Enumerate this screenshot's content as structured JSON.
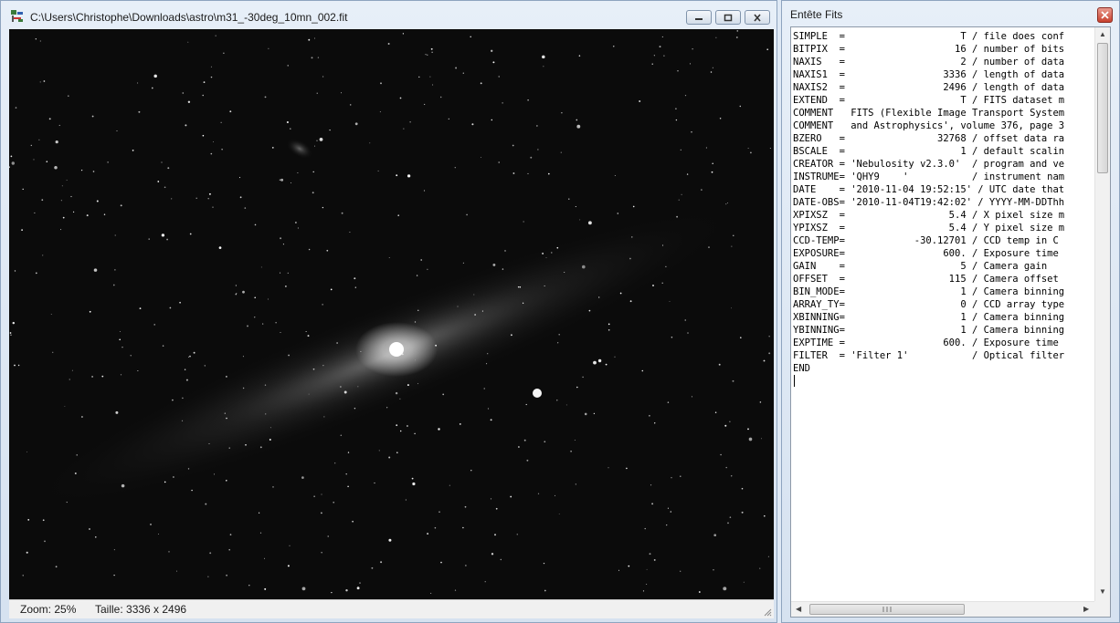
{
  "image_window": {
    "title": "C:\\Users\\Christophe\\Downloads\\astro\\m31_-30deg_10mn_002.fit",
    "icons": [
      "app-icon",
      "minimize-icon",
      "maximize-icon",
      "close-icon"
    ],
    "status": {
      "zoom": "Zoom: 25%",
      "size": "Taille: 3336 x 2496"
    }
  },
  "header_window": {
    "title": "Entête Fits",
    "lines": [
      "SIMPLE  =                    T / file does conf",
      "BITPIX  =                   16 / number of bits",
      "NAXIS   =                    2 / number of data",
      "NAXIS1  =                 3336 / length of data",
      "NAXIS2  =                 2496 / length of data",
      "EXTEND  =                    T / FITS dataset m",
      "COMMENT   FITS (Flexible Image Transport System",
      "COMMENT   and Astrophysics', volume 376, page 3",
      "BZERO   =                32768 / offset data ra",
      "BSCALE  =                    1 / default scalin",
      "CREATOR = 'Nebulosity v2.3.0'  / program and ve",
      "INSTRUME= 'QHY9    '           / instrument nam",
      "DATE    = '2010-11-04 19:52:15' / UTC date that",
      "DATE-OBS= '2010-11-04T19:42:02' / YYYY-MM-DDThh",
      "XPIXSZ  =                  5.4 / X pixel size m",
      "YPIXSZ  =                  5.4 / Y pixel size m",
      "CCD-TEMP=            -30.12701 / CCD temp in C",
      "EXPOSURE=                 600. / Exposure time",
      "GAIN    =                    5 / Camera gain",
      "OFFSET  =                  115 / Camera offset",
      "BIN_MODE=                    1 / Camera binning",
      "ARRAY_TY=                    0 / CCD array type",
      "XBINNING=                    1 / Camera binning",
      "YBINNING=                    1 / Camera binning",
      "EXPTIME =                 600. / Exposure time",
      "FILTER  = 'Filter 1'           / Optical filter",
      "END"
    ]
  },
  "colors": {
    "sky_background": "#0b0b0b",
    "window_frame": "#d6e2f0",
    "close_button": "#c8412e"
  }
}
